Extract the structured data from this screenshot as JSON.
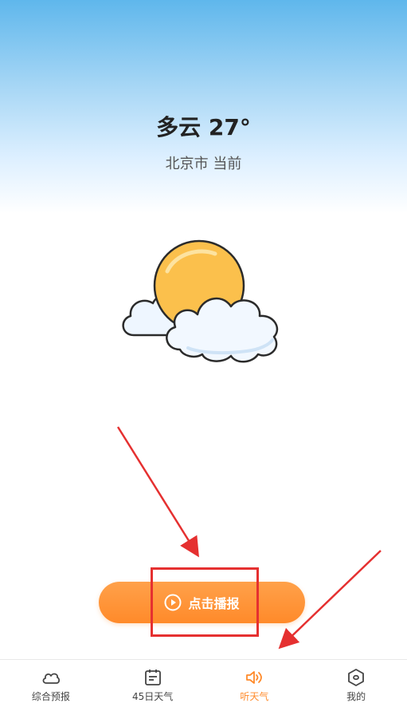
{
  "weather": {
    "condition_temp": "多云 27°",
    "location": "北京市 当前"
  },
  "play_button": {
    "label": "点击播报"
  },
  "tabs": [
    {
      "label": "综合预报",
      "icon": "cloud-icon",
      "active": false
    },
    {
      "label": "45日天气",
      "icon": "calendar-icon",
      "active": false
    },
    {
      "label": "听天气",
      "icon": "speaker-icon",
      "active": true
    },
    {
      "label": "我的",
      "icon": "hexagon-profile-icon",
      "active": false
    }
  ],
  "colors": {
    "accent": "#ff8a2a",
    "annotation": "#e53030",
    "sky_top": "#5fb7ec"
  }
}
